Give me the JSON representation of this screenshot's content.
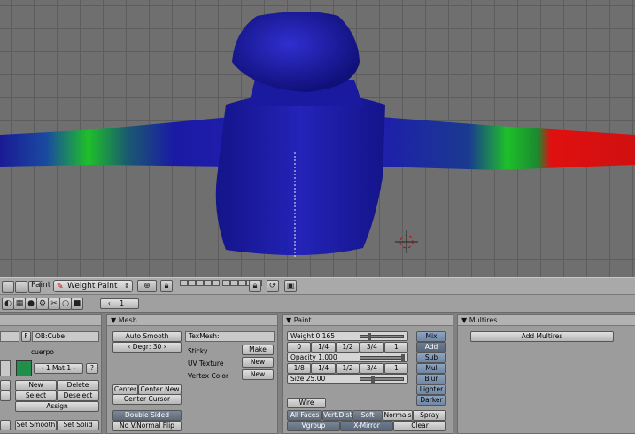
{
  "header": {
    "mode_label": "Paint",
    "mode_value": "Weight Paint",
    "page_number": "1"
  },
  "mesh_link_panel": {
    "ob_name": "OB:Cube",
    "f_label": "F",
    "vertex_group_name": "cuerpo",
    "mat_value": "1 Mat 1",
    "question": "?",
    "new": "New",
    "delete": "Delete",
    "select": "Select",
    "deselect": "Deselect",
    "assign": "Assign",
    "set_smooth": "Set Smooth",
    "set_solid": "Set Solid"
  },
  "mesh_panel": {
    "title": "Mesh",
    "auto_smooth": "Auto Smooth",
    "degr": "Degr: 30",
    "texmesh": "TexMesh:",
    "sticky": "Sticky",
    "make": "Make",
    "uv_texture": "UV Texture",
    "vertex_color": "Vertex Color",
    "new": "New",
    "center": "Center",
    "center_new": "Center New",
    "center_cursor": "Center Cursor",
    "double_sided": "Double Sided",
    "no_v_normal_flip": "No V.Normal Flip"
  },
  "paint_panel": {
    "title": "Paint",
    "weight": "Weight 0.165",
    "weight_value": 0.165,
    "opacity": "Opacity 1.000",
    "opacity_value": 1.0,
    "size": "Size 25.00",
    "size_fraction": 0.25,
    "weight_presets": [
      "0",
      "1/4",
      "1/2",
      "3/4",
      "1"
    ],
    "opacity_presets": [
      "1/8",
      "1/4",
      "1/2",
      "3/4",
      "1"
    ],
    "modes": [
      "Mix",
      "Add",
      "Sub",
      "Mul",
      "Blur",
      "Lighter",
      "Darker"
    ],
    "active_mode": "Add",
    "wire": "Wire",
    "all_faces": "All Faces",
    "vert_dist": "Vert.Dist",
    "soft": "Soft",
    "normals": "Normals",
    "spray": "Spray",
    "vgroup": "Vgroup",
    "x_mirror": "X-Mirror",
    "clear": "Clear"
  },
  "multires_panel": {
    "title": "Multires",
    "add_multires": "Add Multires"
  },
  "colors": {
    "mesh_body": "#1b1b9b",
    "weight_green": "#1fbf2a",
    "weight_red": "#e01010"
  }
}
